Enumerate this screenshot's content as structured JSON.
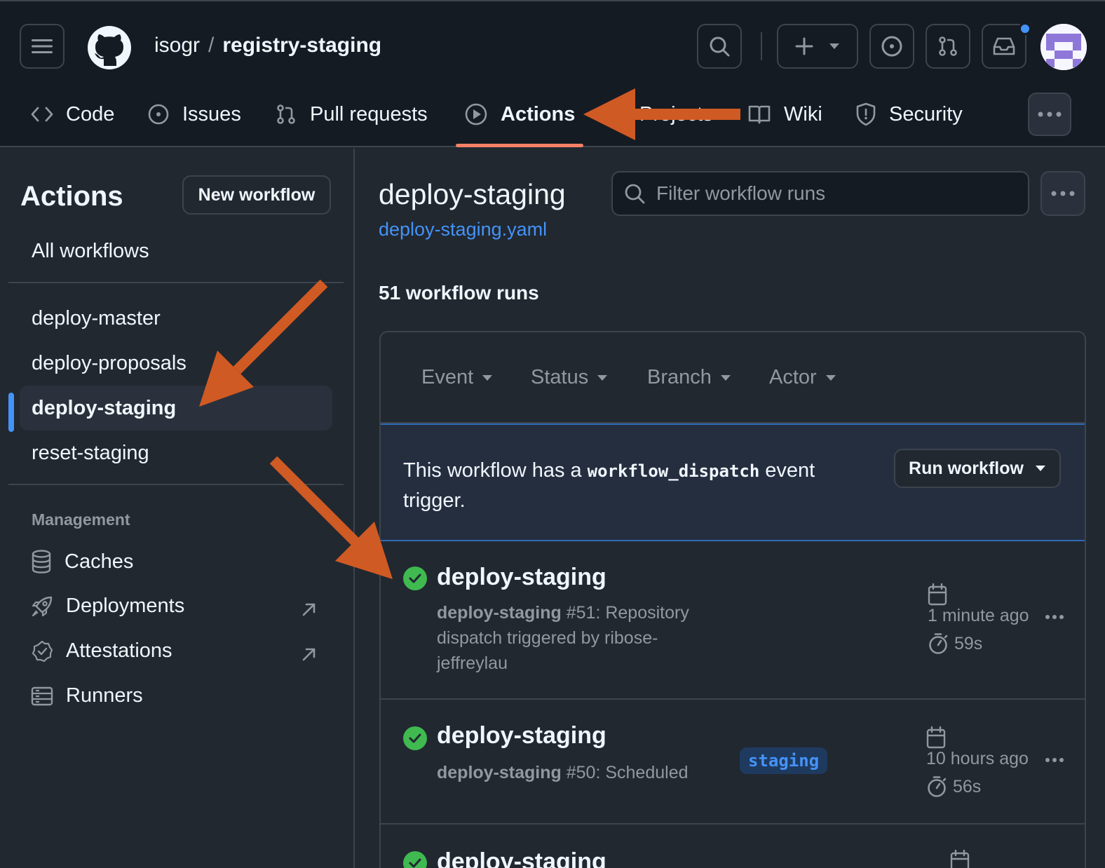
{
  "header": {
    "owner": "isogr",
    "separator": "/",
    "repo": "registry-staging",
    "plus_label": "+"
  },
  "tabs": [
    {
      "label": "Code",
      "icon": "code-icon"
    },
    {
      "label": "Issues",
      "icon": "issue-opened-icon"
    },
    {
      "label": "Pull requests",
      "icon": "git-pull-request-icon"
    },
    {
      "label": "Actions",
      "icon": "play-icon",
      "active": true
    },
    {
      "label": "Projects",
      "icon": "table-icon"
    },
    {
      "label": "Wiki",
      "icon": "book-icon"
    },
    {
      "label": "Security",
      "icon": "shield-icon"
    }
  ],
  "sidebar": {
    "title": "Actions",
    "new_workflow": "New workflow",
    "all_workflows": "All workflows",
    "workflows": [
      {
        "label": "deploy-master"
      },
      {
        "label": "deploy-proposals"
      },
      {
        "label": "deploy-staging",
        "active": true
      },
      {
        "label": "reset-staging"
      }
    ],
    "management_title": "Management",
    "management": [
      {
        "label": "Caches",
        "icon": "database-icon"
      },
      {
        "label": "Deployments",
        "icon": "rocket-icon",
        "external": true
      },
      {
        "label": "Attestations",
        "icon": "verified-icon",
        "external": true
      },
      {
        "label": "Runners",
        "icon": "server-icon"
      }
    ]
  },
  "main": {
    "title": "deploy-staging",
    "file_link": "deploy-staging.yaml",
    "filter_placeholder": "Filter workflow runs",
    "run_count": "51 workflow runs",
    "filters": [
      "Event",
      "Status",
      "Branch",
      "Actor"
    ],
    "dispatch": {
      "text_before": "This workflow has a",
      "code": "workflow_dispatch",
      "text_after": "event trigger.",
      "button": "Run workflow"
    },
    "runs": [
      {
        "title": "deploy-staging",
        "workflow": "deploy-staging",
        "detail": "#51: Repository dispatch triggered by ribose-jeffreylau",
        "time": "1 minute ago",
        "duration": "59s",
        "status": "success"
      },
      {
        "title": "deploy-staging",
        "workflow": "deploy-staging",
        "detail": "#50: Scheduled",
        "branch": "staging",
        "time": "10 hours ago",
        "duration": "56s",
        "status": "success"
      },
      {
        "title": "deploy-staging",
        "status": "success"
      }
    ]
  },
  "colors": {
    "accent": "#4493f8",
    "success": "#3fb950",
    "tab_underline": "#f78166",
    "annotation_arrow": "#d05a23"
  }
}
